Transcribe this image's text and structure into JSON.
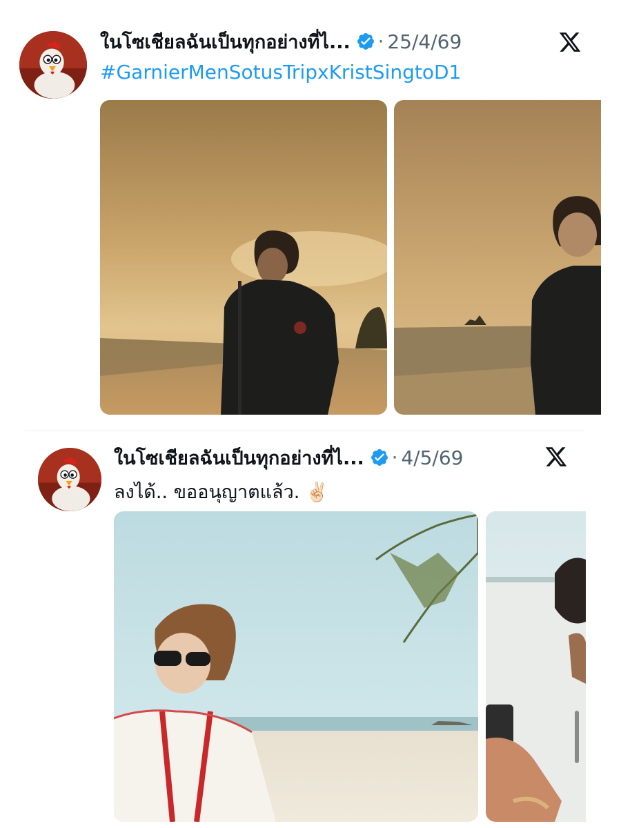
{
  "posts": [
    {
      "author_name": "ในโซเชียลฉันเป็นทุกอย่างที่ไ...",
      "verified": true,
      "separator": "·",
      "date": "25/4/69",
      "hashtag": "#GarnierMenSotusTripxKristSingtoD1",
      "media": [
        {
          "description_icon": "photo",
          "tone": "sunset-beach"
        },
        {
          "description_icon": "photo",
          "tone": "sunset-beach"
        }
      ]
    },
    {
      "author_name": "ในโซเชียลฉันเป็นทุกอย่างที่ไ...",
      "verified": true,
      "separator": "·",
      "date": "4/5/69",
      "text": "ลงได้.. ขออนุญาตแล้ว.",
      "emoji": "✌🏻",
      "media": [
        {
          "description_icon": "photo",
          "tone": "day-beach"
        },
        {
          "description_icon": "photo",
          "tone": "day-beach"
        }
      ]
    }
  ],
  "colors": {
    "accent_blue": "#1d9bf0",
    "verified_blue": "#1d9bf0",
    "text_primary": "#0f1419",
    "text_secondary": "#536471",
    "divider": "#e6ecf0"
  },
  "icons": {
    "verified": "verified-badge-icon",
    "platform": "x-logo-icon",
    "avatar": "cartoon-chicken-avatar"
  }
}
